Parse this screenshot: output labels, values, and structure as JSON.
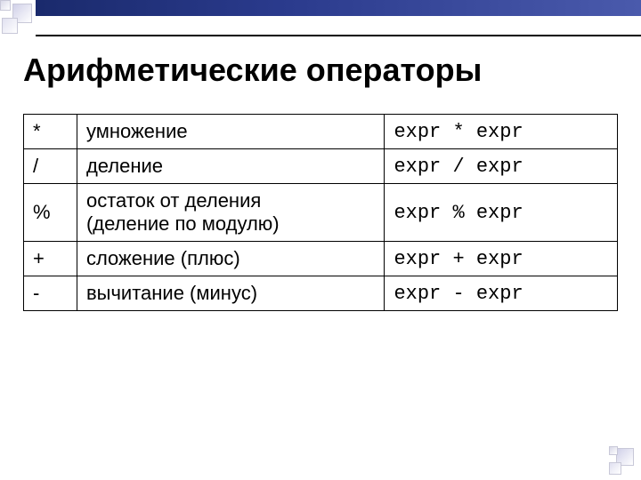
{
  "title": "Арифметические операторы",
  "rows": [
    {
      "op": "*",
      "desc": "умножение",
      "desc2": "",
      "syntax": "expr * expr"
    },
    {
      "op": "/",
      "desc": "деление",
      "desc2": "",
      "syntax": "expr / expr"
    },
    {
      "op": "%",
      "desc": "остаток от деления",
      "desc2": "(деление по модулю)",
      "syntax": "expr % expr"
    },
    {
      "op": "+",
      "desc": "сложение (плюс)",
      "desc2": "",
      "syntax": "expr + expr"
    },
    {
      "op": "-",
      "desc": "вычитание (минус)",
      "desc2": "",
      "syntax": "expr - expr"
    }
  ]
}
